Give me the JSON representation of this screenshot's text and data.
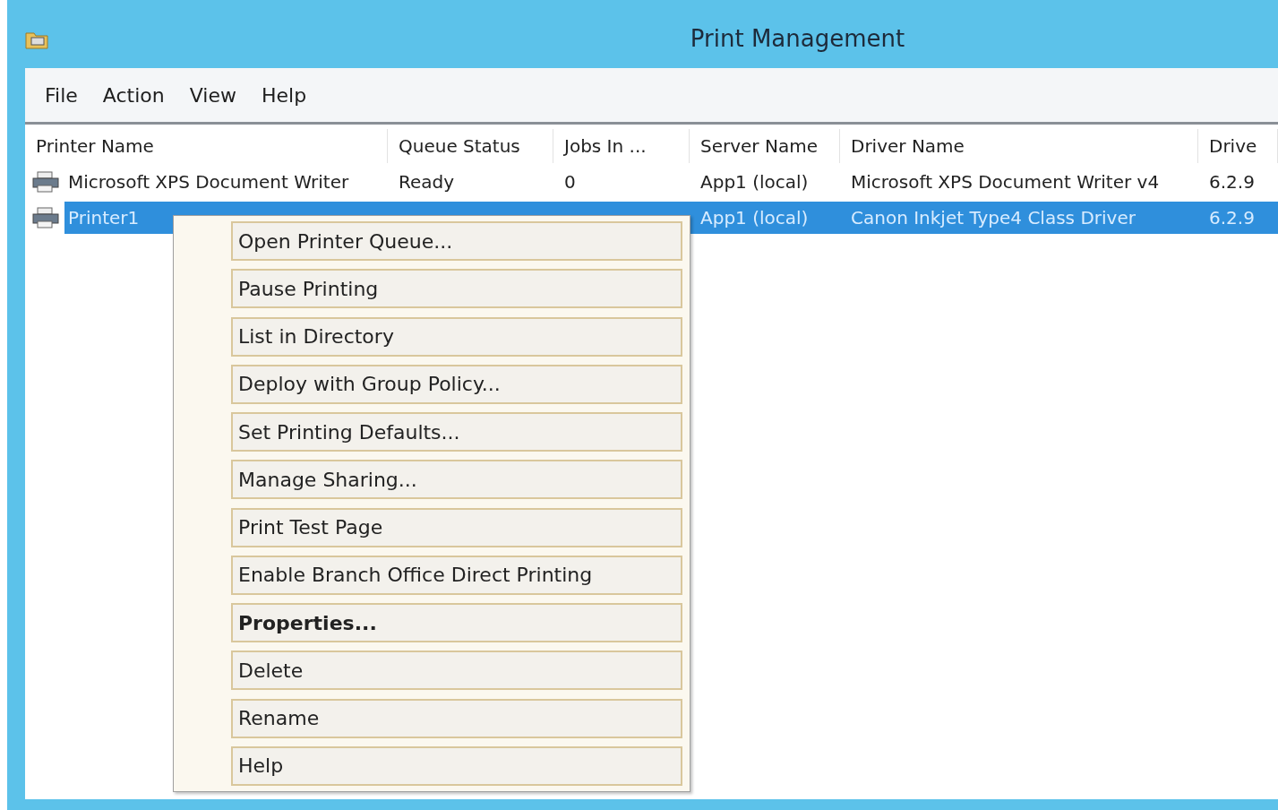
{
  "window": {
    "title": "Print Management"
  },
  "menu_bar": [
    "File",
    "Action",
    "View",
    "Help"
  ],
  "table": {
    "columns": [
      "Printer Name",
      "Queue Status",
      "Jobs In ...",
      "Server Name",
      "Driver Name",
      "Drive"
    ],
    "rows": [
      {
        "selected": false,
        "cells": [
          "Microsoft XPS Document Writer",
          "Ready",
          "0",
          "App1 (local)",
          "Microsoft XPS Document Writer v4",
          "6.2.9"
        ]
      },
      {
        "selected": true,
        "cells": [
          "Printer1",
          null,
          null,
          "App1 (local)",
          "Canon Inkjet Type4 Class Driver",
          "6.2.9"
        ]
      }
    ]
  },
  "context_menu": [
    {
      "label": "Open Printer Queue...",
      "bold": false
    },
    {
      "label": "Pause Printing",
      "bold": false
    },
    {
      "label": "List in Directory",
      "bold": false
    },
    {
      "label": "Deploy with Group Policy...",
      "bold": false
    },
    {
      "label": "Set Printing Defaults...",
      "bold": false
    },
    {
      "label": "Manage Sharing...",
      "bold": false
    },
    {
      "label": "Print Test Page",
      "bold": false
    },
    {
      "label": "Enable Branch Office Direct Printing",
      "bold": false
    },
    {
      "label": "Properties...",
      "bold": true
    },
    {
      "label": "Delete",
      "bold": false
    },
    {
      "label": "Rename",
      "bold": false
    },
    {
      "label": "Help",
      "bold": false
    }
  ]
}
